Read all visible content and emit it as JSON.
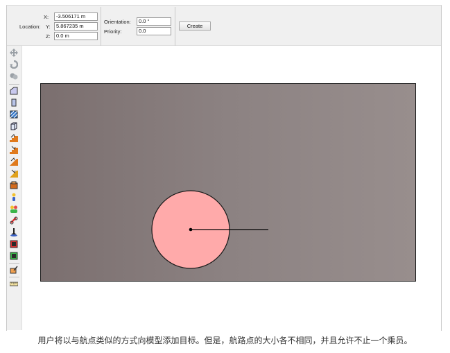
{
  "location": {
    "label": "Location:",
    "x_label": "X:",
    "x_value": "-3.506171 m",
    "y_label": "Y:",
    "y_value": "5.867235 m",
    "z_label": "Z:",
    "z_value": "0.0 m"
  },
  "orientation": {
    "label": "Orientation:",
    "value": "0.0 °"
  },
  "priority": {
    "label": "Priority:",
    "value": "0.0"
  },
  "create_button": "Create",
  "toolbar_icons": [
    "move-icon",
    "rotate-icon",
    "group-icon",
    "wall-icon",
    "door-icon",
    "window-icon",
    "box-icon",
    "stair-up-icon",
    "stair-down-icon",
    "escalator-up-icon",
    "escalator-down-icon",
    "obstruction-icon",
    "occupant-icon",
    "group-occupants-icon",
    "link-icon",
    "target-icon",
    "exit-icon",
    "entrance-icon",
    "edit-icon",
    "measure-icon"
  ],
  "colors": {
    "room_fill": "#8c8282",
    "target_fill": "#ffaaaa",
    "toolbar_bg": "#f0f0f0"
  },
  "caption": "用户将以与航点类似的方式向模型添加目标。但是，航路点的大小各不相同，并且允许不止一个乘员。"
}
